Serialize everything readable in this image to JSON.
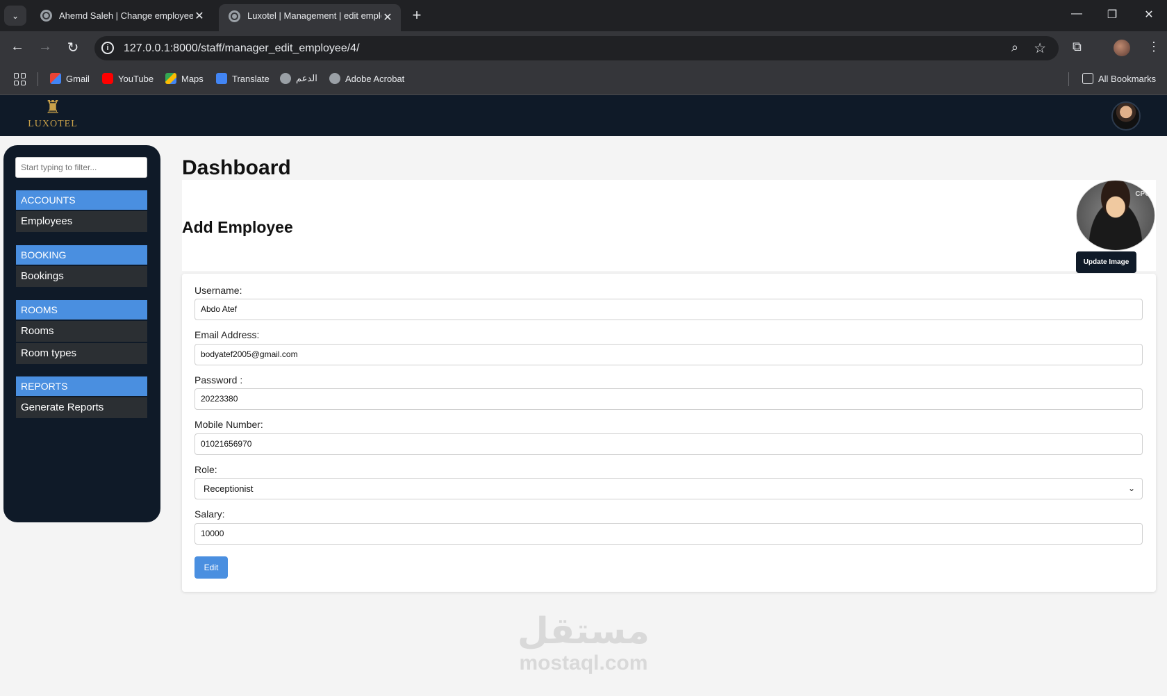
{
  "browser": {
    "tabs": [
      {
        "title": "Ahemd Saleh | Change employee |",
        "active": false
      },
      {
        "title": "Luxotel | Management | edit employee",
        "active": true
      }
    ],
    "url": "127.0.0.1:8000/staff/manager_edit_employee/4/",
    "bookmarks": [
      {
        "label": "Gmail",
        "icon": "gmail-icon"
      },
      {
        "label": "YouTube",
        "icon": "youtube-icon"
      },
      {
        "label": "Maps",
        "icon": "maps-icon"
      },
      {
        "label": "Translate",
        "icon": "translate-icon"
      },
      {
        "label": "الدعم",
        "icon": "globe-icon"
      },
      {
        "label": "Adobe Acrobat",
        "icon": "globe-icon"
      }
    ],
    "all_bookmarks": "All Bookmarks"
  },
  "header": {
    "logo_text": "LUXOTEL"
  },
  "sidebar": {
    "filter_placeholder": "Start typing to filter...",
    "sections": [
      {
        "heading": "ACCOUNTS",
        "items": [
          "Employees"
        ]
      },
      {
        "heading": "BOOKING",
        "items": [
          "Bookings"
        ]
      },
      {
        "heading": "ROOMS",
        "items": [
          "Rooms",
          "Room types"
        ]
      },
      {
        "heading": "REPORTS",
        "items": [
          "Generate Reports"
        ]
      }
    ]
  },
  "main": {
    "page_title": "Dashboard",
    "card_title": "Add Employee",
    "avatar_badge": "CPO",
    "update_image_label": "Update Image",
    "form": {
      "username_label": "Username:",
      "username_value": "Abdo Atef",
      "email_label": "Email Address:",
      "email_value": "bodyatef2005@gmail.com",
      "password_label": "Password :",
      "password_value": "20223380",
      "mobile_label": "Mobile Number:",
      "mobile_value": "01021656970",
      "role_label": "Role:",
      "role_value": "Receptionist",
      "salary_label": "Salary:",
      "salary_value": "10000",
      "submit_label": "Edit"
    }
  },
  "watermark": {
    "arabic": "مستقل",
    "latin": "mostaql.com"
  },
  "colors": {
    "nav_dark": "#0f1a28",
    "accent_blue": "#4a8fe0",
    "sidebar_item": "#2b2f33",
    "gold": "#c9a14a"
  }
}
